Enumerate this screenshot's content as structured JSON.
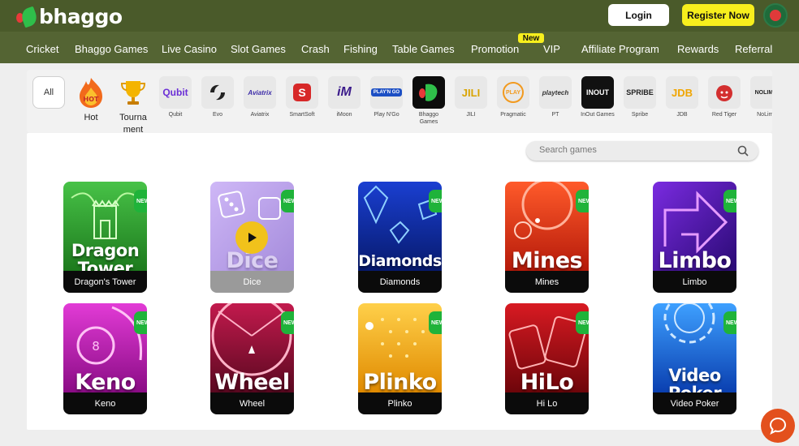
{
  "header": {
    "logo_text": "bhaggo",
    "login_label": "Login",
    "register_label": "Register Now",
    "colors": {
      "topbar": "#4a5a2a",
      "navbar": "#546433",
      "register": "#f7ef1d"
    }
  },
  "nav": {
    "items": [
      "Cricket",
      "Bhaggo Games",
      "Live Casino",
      "Slot Games",
      "Crash",
      "Fishing",
      "Table Games",
      "Promotion",
      "VIP",
      "Affiliate Program",
      "Rewards",
      "Referral"
    ],
    "vip_tag": "New"
  },
  "providers": {
    "all_label": "All",
    "items": [
      {
        "label": "Hot",
        "icon": "fire-icon"
      },
      {
        "label": "Tournament",
        "icon": "trophy-icon"
      },
      {
        "label": "Qubit",
        "logo": "Qubit"
      },
      {
        "label": "Evo",
        "logo": "Evo"
      },
      {
        "label": "Aviatrix",
        "logo": "Aviatrix"
      },
      {
        "label": "SmartSoft",
        "logo": "S"
      },
      {
        "label": "iMoon",
        "logo": "iM"
      },
      {
        "label": "Play N'Go",
        "logo": "PLAY'N GO"
      },
      {
        "label": "Bhaggo Games",
        "logo": ""
      },
      {
        "label": "JILI",
        "logo": "JILI"
      },
      {
        "label": "Pragmatic",
        "logo": "PLAY"
      },
      {
        "label": "PT",
        "logo": "playtech"
      },
      {
        "label": "InOut Games",
        "logo": "INOUT"
      },
      {
        "label": "Spribe",
        "logo": "SPRIBE"
      },
      {
        "label": "JDB",
        "logo": "JDB"
      },
      {
        "label": "Red Tiger",
        "logo": ""
      },
      {
        "label": "NoLimit",
        "logo": "NOLIMIT"
      }
    ]
  },
  "search": {
    "placeholder": "Search games"
  },
  "games": [
    {
      "name": "Dragon's Tower",
      "art_title": "Dragon Tower",
      "badge": "NEW",
      "color": "#2e9a2e"
    },
    {
      "name": "Dice",
      "art_title": "Dice",
      "badge": "NEW",
      "color": "#7b4fd0"
    },
    {
      "name": "Diamonds",
      "art_title": "Diamonds",
      "badge": "NEW",
      "color": "#0d2fa8"
    },
    {
      "name": "Mines",
      "art_title": "Mines",
      "badge": "NEW",
      "color": "#d8321a"
    },
    {
      "name": "Limbo",
      "art_title": "Limbo",
      "badge": "NEW",
      "color": "#5a19b0"
    },
    {
      "name": "Keno",
      "art_title": "Keno",
      "badge": "NEW",
      "color": "#b219a8"
    },
    {
      "name": "Wheel",
      "art_title": "Wheel",
      "badge": "NEW",
      "color": "#a01446"
    },
    {
      "name": "Plinko",
      "art_title": "Plinko",
      "badge": "NEW",
      "color": "#f0a51a"
    },
    {
      "name": "Hi Lo",
      "art_title": "HiLo",
      "badge": "NEW",
      "color": "#b0121a"
    },
    {
      "name": "Video Poker",
      "art_title": "Video Poker",
      "badge": "NEW",
      "color": "#1a6be0"
    }
  ]
}
